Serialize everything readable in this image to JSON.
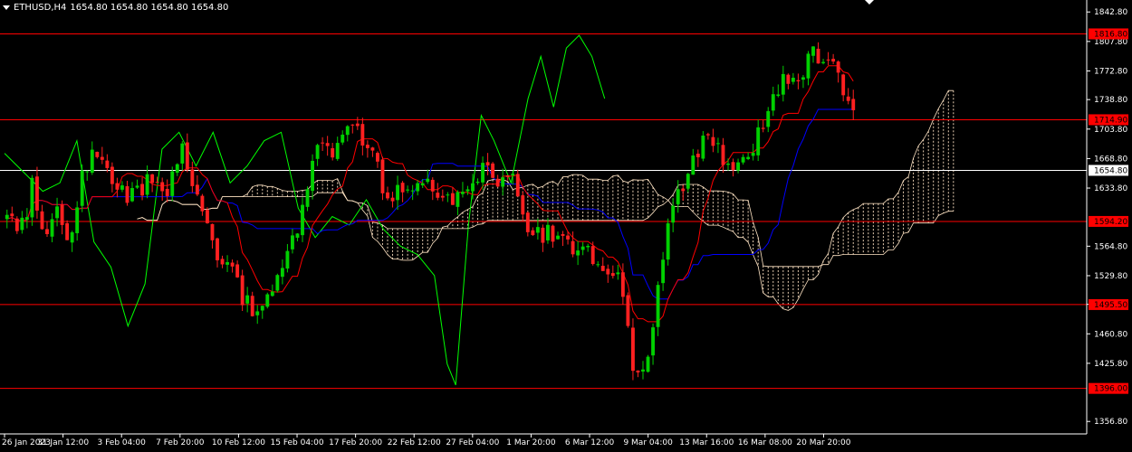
{
  "window": {
    "symbol": "ETHUSD,H4",
    "ohlc": "1654.80 1654.80 1654.80 1654.80",
    "header_icon": "triangle-down-icon"
  },
  "colors": {
    "background": "#000000",
    "axis": "#ffffff",
    "up_candle": "#00d000",
    "down_candle": "#ff2020",
    "tenkan": "#ff0000",
    "kijun": "#0000ff",
    "chikou": "#00ff00",
    "cloud_border": "#ffe4c4",
    "level_line": "#ff0000",
    "level_label_bg": "#ff0000",
    "bid_line": "#ffffff"
  },
  "chart_data": {
    "type": "candlestick",
    "instrument": "ETHUSD",
    "timeframe": "H4",
    "grid": false,
    "ylim": [
      1342,
      1857
    ],
    "y_ticks": [
      "1842.80",
      "1807.80",
      "1772.80",
      "1738.80",
      "1703.80",
      "1668.80",
      "1633.80",
      "1564.80",
      "1529.80",
      "1495.80",
      "1460.80",
      "1425.80",
      "1356.80"
    ],
    "x_ticks": [
      "26 Jan 2023",
      "31 Jan 12:00",
      "3 Feb 04:00",
      "7 Feb 20:00",
      "10 Feb 12:00",
      "15 Feb 04:00",
      "17 Feb 20:00",
      "22 Feb 12:00",
      "27 Feb 04:00",
      "1 Mar 20:00",
      "6 Mar 12:00",
      "9 Mar 04:00",
      "13 Mar 16:00",
      "16 Mar 08:00",
      "20 Mar 20:00"
    ],
    "level_lines": [
      {
        "value": 1816.8,
        "label": "1816.80"
      },
      {
        "value": 1714.9,
        "label": "1714.90"
      },
      {
        "value": 1594.2,
        "label": "1594.20"
      },
      {
        "value": 1495.5,
        "label": "1495.50"
      },
      {
        "value": 1396.0,
        "label": "1396.00"
      }
    ],
    "bid": {
      "value": 1654.8,
      "label": "1654.80"
    },
    "price_path": [
      {
        "t": 0.0,
        "p": 1600
      },
      {
        "t": 0.02,
        "p": 1585
      },
      {
        "t": 0.03,
        "p": 1640
      },
      {
        "t": 0.045,
        "p": 1580
      },
      {
        "t": 0.06,
        "p": 1610
      },
      {
        "t": 0.075,
        "p": 1570
      },
      {
        "t": 0.09,
        "p": 1660
      },
      {
        "t": 0.11,
        "p": 1675
      },
      {
        "t": 0.13,
        "p": 1640
      },
      {
        "t": 0.15,
        "p": 1620
      },
      {
        "t": 0.17,
        "p": 1650
      },
      {
        "t": 0.19,
        "p": 1635
      },
      {
        "t": 0.205,
        "p": 1680
      },
      {
        "t": 0.23,
        "p": 1620
      },
      {
        "t": 0.25,
        "p": 1555
      },
      {
        "t": 0.265,
        "p": 1540
      },
      {
        "t": 0.28,
        "p": 1500
      },
      {
        "t": 0.3,
        "p": 1485
      },
      {
        "t": 0.32,
        "p": 1540
      },
      {
        "t": 0.34,
        "p": 1580
      },
      {
        "t": 0.355,
        "p": 1635
      },
      {
        "t": 0.37,
        "p": 1700
      },
      {
        "t": 0.385,
        "p": 1680
      },
      {
        "t": 0.4,
        "p": 1710
      },
      {
        "t": 0.425,
        "p": 1690
      },
      {
        "t": 0.45,
        "p": 1620
      },
      {
        "t": 0.47,
        "p": 1640
      },
      {
        "t": 0.49,
        "p": 1645
      },
      {
        "t": 0.515,
        "p": 1625
      },
      {
        "t": 0.54,
        "p": 1620
      },
      {
        "t": 0.56,
        "p": 1660
      },
      {
        "t": 0.58,
        "p": 1640
      },
      {
        "t": 0.6,
        "p": 1640
      },
      {
        "t": 0.615,
        "p": 1575
      },
      {
        "t": 0.64,
        "p": 1580
      },
      {
        "t": 0.66,
        "p": 1565
      },
      {
        "t": 0.68,
        "p": 1560
      },
      {
        "t": 0.7,
        "p": 1550
      },
      {
        "t": 0.725,
        "p": 1520
      },
      {
        "t": 0.74,
        "p": 1420
      },
      {
        "t": 0.76,
        "p": 1430
      },
      {
        "t": 0.775,
        "p": 1560
      },
      {
        "t": 0.79,
        "p": 1620
      },
      {
        "t": 0.81,
        "p": 1660
      },
      {
        "t": 0.825,
        "p": 1700
      },
      {
        "t": 0.84,
        "p": 1685
      },
      {
        "t": 0.855,
        "p": 1650
      },
      {
        "t": 0.875,
        "p": 1670
      },
      {
        "t": 0.89,
        "p": 1700
      },
      {
        "t": 0.905,
        "p": 1740
      },
      {
        "t": 0.92,
        "p": 1770
      },
      {
        "t": 0.935,
        "p": 1760
      },
      {
        "t": 0.95,
        "p": 1790
      },
      {
        "t": 0.965,
        "p": 1795
      },
      {
        "t": 0.98,
        "p": 1770
      },
      {
        "t": 1.0,
        "p": 1725
      }
    ],
    "chikou_path": [
      {
        "t": 0.0,
        "p": 1675
      },
      {
        "t": 0.025,
        "p": 1650
      },
      {
        "t": 0.045,
        "p": 1630
      },
      {
        "t": 0.065,
        "p": 1640
      },
      {
        "t": 0.085,
        "p": 1690
      },
      {
        "t": 0.105,
        "p": 1570
      },
      {
        "t": 0.125,
        "p": 1540
      },
      {
        "t": 0.145,
        "p": 1470
      },
      {
        "t": 0.165,
        "p": 1520
      },
      {
        "t": 0.185,
        "p": 1680
      },
      {
        "t": 0.205,
        "p": 1700
      },
      {
        "t": 0.225,
        "p": 1660
      },
      {
        "t": 0.245,
        "p": 1700
      },
      {
        "t": 0.265,
        "p": 1640
      },
      {
        "t": 0.285,
        "p": 1660
      },
      {
        "t": 0.305,
        "p": 1690
      },
      {
        "t": 0.325,
        "p": 1700
      },
      {
        "t": 0.345,
        "p": 1610
      },
      {
        "t": 0.365,
        "p": 1575
      },
      {
        "t": 0.385,
        "p": 1600
      },
      {
        "t": 0.405,
        "p": 1590
      },
      {
        "t": 0.425,
        "p": 1620
      },
      {
        "t": 0.445,
        "p": 1585
      },
      {
        "t": 0.465,
        "p": 1565
      },
      {
        "t": 0.485,
        "p": 1555
      },
      {
        "t": 0.505,
        "p": 1530
      },
      {
        "t": 0.52,
        "p": 1425
      },
      {
        "t": 0.53,
        "p": 1400
      },
      {
        "t": 0.545,
        "p": 1590
      },
      {
        "t": 0.56,
        "p": 1720
      },
      {
        "t": 0.575,
        "p": 1690
      },
      {
        "t": 0.595,
        "p": 1640
      },
      {
        "t": 0.615,
        "p": 1740
      },
      {
        "t": 0.63,
        "p": 1790
      },
      {
        "t": 0.645,
        "p": 1730
      },
      {
        "t": 0.66,
        "p": 1800
      },
      {
        "t": 0.675,
        "p": 1815
      },
      {
        "t": 0.69,
        "p": 1790
      },
      {
        "t": 0.705,
        "p": 1740
      }
    ]
  }
}
